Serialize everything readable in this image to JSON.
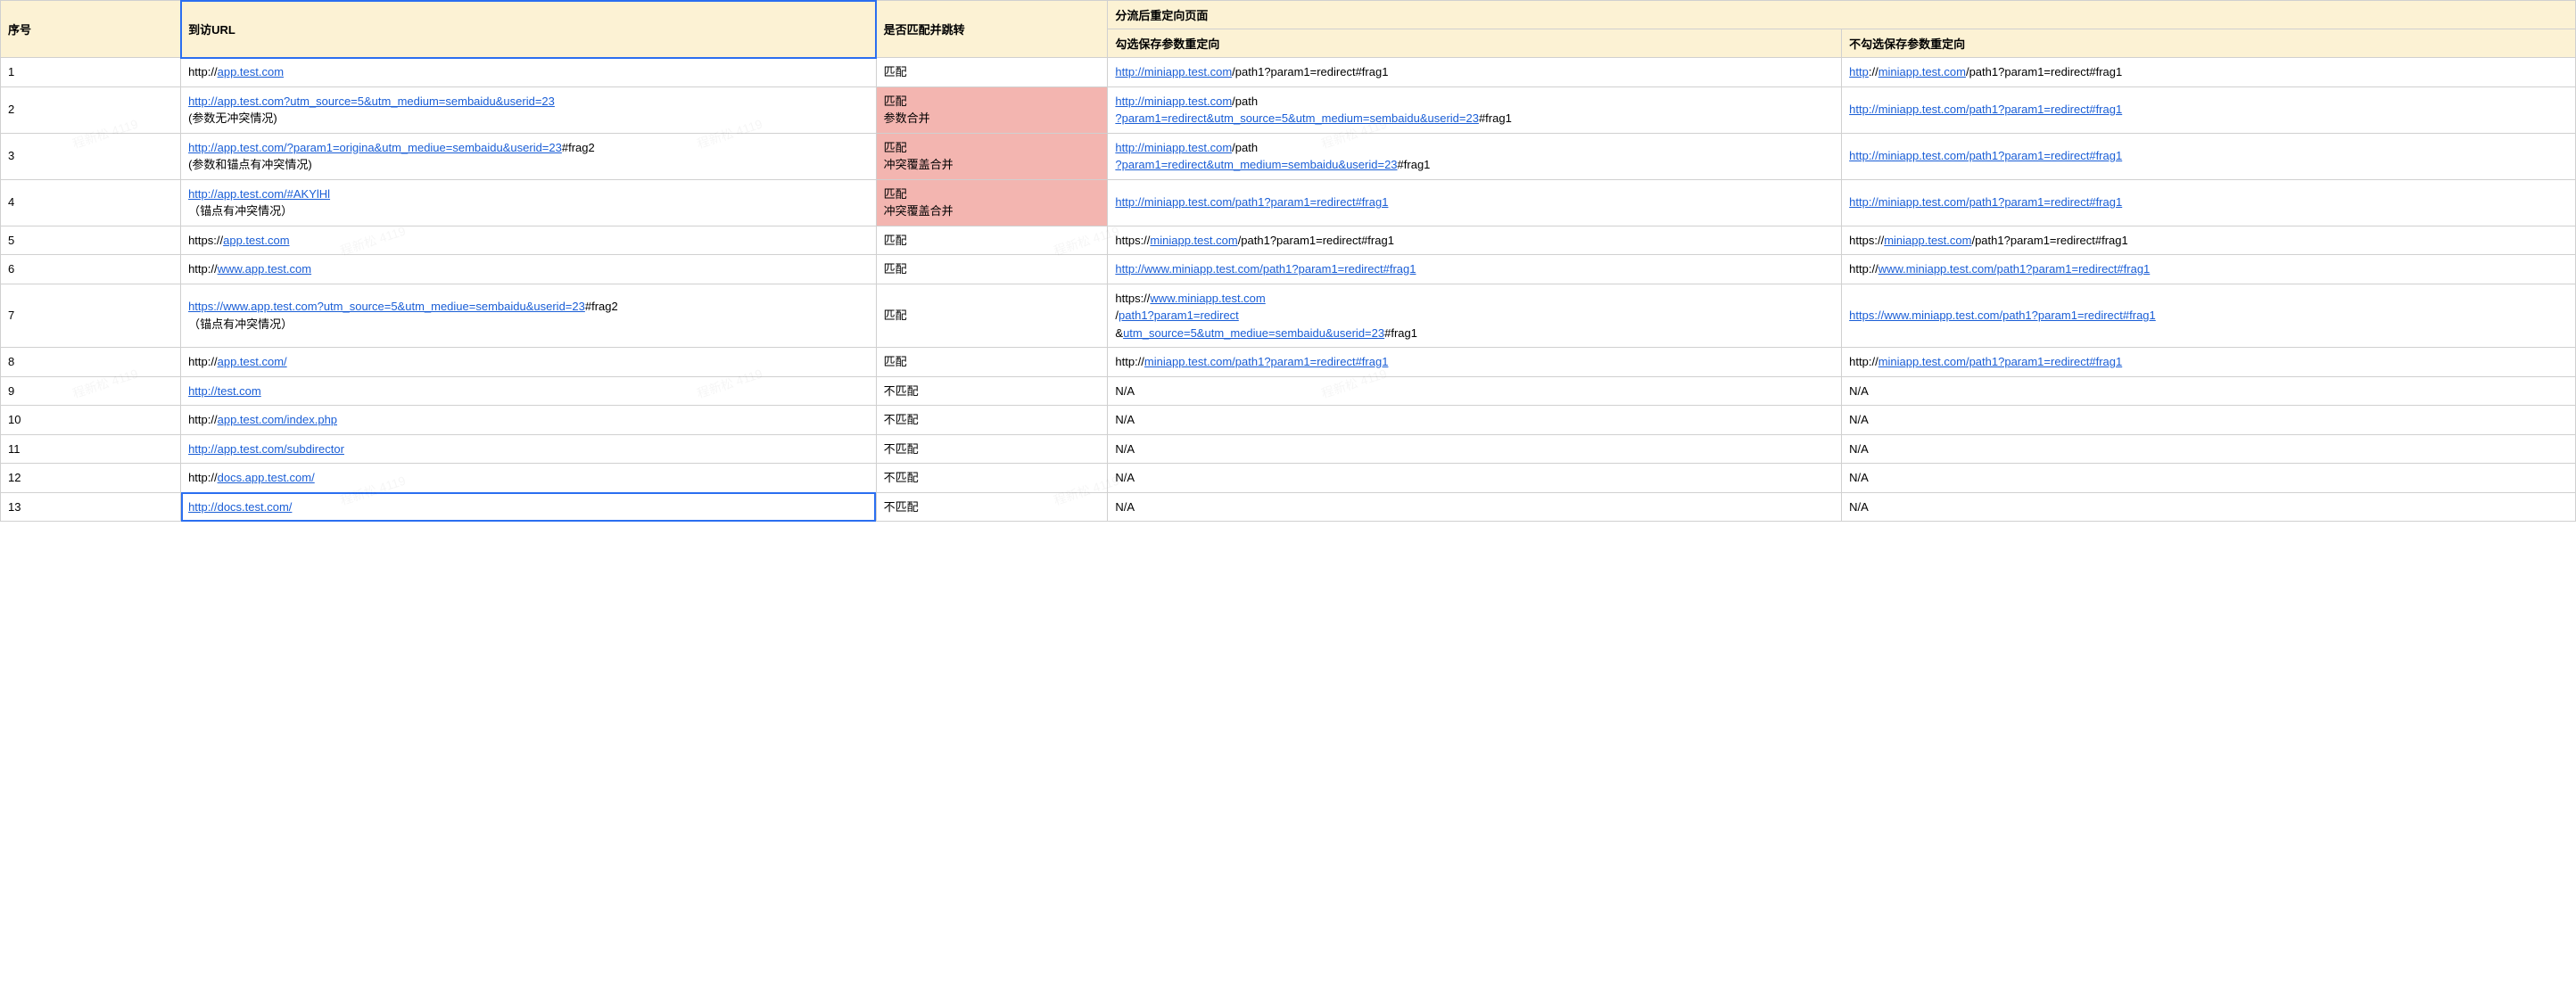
{
  "watermark_text": "程新松 4119",
  "headers": {
    "seq": "序号",
    "url": "到访URL",
    "match": "是否匹配并跳转",
    "redirect_group": "分流后重定向页面",
    "redirect_keep": "勾选保存参数重定向",
    "redirect_nokeep": "不勾选保存参数重定向"
  },
  "rows": [
    {
      "seq": "1",
      "url": [
        {
          "t": "plain",
          "v": "http://"
        },
        {
          "t": "link",
          "v": "app.test.com"
        }
      ],
      "match": {
        "pink": false,
        "text": "匹配"
      },
      "keep": [
        {
          "t": "link",
          "v": "http://miniapp.test.com"
        },
        {
          "t": "plain",
          "v": "/path1?param1=redirect#frag1"
        }
      ],
      "nokeep": [
        {
          "t": "link",
          "v": "http"
        },
        {
          "t": "plain",
          "v": "://"
        },
        {
          "t": "link",
          "v": "miniapp.test.com"
        },
        {
          "t": "plain",
          "v": "/path1?param1=redirect#frag1"
        }
      ]
    },
    {
      "seq": "2",
      "url": [
        {
          "t": "link",
          "v": "http://app.test.com?utm_source=5&utm_medium=sembaidu&userid=23"
        },
        {
          "t": "br"
        },
        {
          "t": "plain",
          "v": "(参数无冲突情况)"
        }
      ],
      "match": {
        "pink": true,
        "text": "匹配\n 参数合并"
      },
      "keep": [
        {
          "t": "link",
          "v": "http://miniapp.test.com"
        },
        {
          "t": "plain",
          "v": "/path"
        },
        {
          "t": "br"
        },
        {
          "t": "link",
          "v": "?param1=redirect&utm_source=5&utm_medium=sembaidu&userid=23"
        },
        {
          "t": "plain",
          "v": "#frag1"
        }
      ],
      "nokeep": [
        {
          "t": "link",
          "v": "http://miniapp.test.com/path1?param1=redirect#frag1"
        }
      ]
    },
    {
      "seq": "3",
      "url": [
        {
          "t": "link",
          "v": "http://app.test.com/?param1=origina&utm_mediue=sembaidu&userid=23"
        },
        {
          "t": "plain",
          "v": "#frag2"
        },
        {
          "t": "br"
        },
        {
          "t": "plain",
          "v": "(参数和锚点有冲突情况)"
        }
      ],
      "match": {
        "pink": true,
        "text": "匹配\n冲突覆盖合并"
      },
      "keep": [
        {
          "t": "link",
          "v": "http://miniapp.test.com"
        },
        {
          "t": "plain",
          "v": "/path"
        },
        {
          "t": "br"
        },
        {
          "t": "link",
          "v": "?param1=redirect&utm_medium=sembaidu&userid=23"
        },
        {
          "t": "plain",
          "v": "#frag1"
        }
      ],
      "nokeep": [
        {
          "t": "link",
          "v": "http://miniapp.test.com/path1?param1=redirect#frag1"
        }
      ]
    },
    {
      "seq": "4",
      "url": [
        {
          "t": "link",
          "v": "http://app.test.com/#AKYlHl"
        },
        {
          "t": "br"
        },
        {
          "t": "plain",
          "v": "（锚点有冲突情况）"
        }
      ],
      "match": {
        "pink": true,
        "text": "匹配\n冲突覆盖合并"
      },
      "keep": [
        {
          "t": "link",
          "v": "http://miniapp.test.com/path1?param1=redirect#frag1"
        }
      ],
      "nokeep": [
        {
          "t": "link",
          "v": "http://miniapp.test.com/path1?param1=redirect#frag1"
        }
      ]
    },
    {
      "seq": "5",
      "url": [
        {
          "t": "plain",
          "v": "https://"
        },
        {
          "t": "link",
          "v": "app.test.com"
        }
      ],
      "match": {
        "pink": false,
        "text": "匹配"
      },
      "keep": [
        {
          "t": "plain",
          "v": "https://"
        },
        {
          "t": "link",
          "v": "miniapp.test.com"
        },
        {
          "t": "plain",
          "v": "/path1?param1=redirect#frag1"
        }
      ],
      "nokeep": [
        {
          "t": "plain",
          "v": "https://"
        },
        {
          "t": "link",
          "v": "miniapp.test.com"
        },
        {
          "t": "plain",
          "v": "/path1?param1=redirect#frag1"
        }
      ]
    },
    {
      "seq": "6",
      "url": [
        {
          "t": "plain",
          "v": "http://"
        },
        {
          "t": "link",
          "v": "www.app.test.com"
        }
      ],
      "match": {
        "pink": false,
        "text": "匹配"
      },
      "keep": [
        {
          "t": "link",
          "v": "http://www.miniapp.test.com/path1?param1=redirect#frag1"
        }
      ],
      "nokeep": [
        {
          "t": "plain",
          "v": "http://"
        },
        {
          "t": "link",
          "v": "www.miniapp.test.com/path1?param1=redirect#frag1"
        }
      ]
    },
    {
      "seq": "7",
      "url": [
        {
          "t": "link",
          "v": "https://www.app.test.com?utm_source=5&utm_mediue=sembaidu&userid=23"
        },
        {
          "t": "plain",
          "v": "#frag2"
        },
        {
          "t": "br"
        },
        {
          "t": "plain",
          "v": "（锚点有冲突情况）"
        }
      ],
      "match": {
        "pink": false,
        "text": "匹配"
      },
      "keep": [
        {
          "t": "plain",
          "v": "https://"
        },
        {
          "t": "link",
          "v": "www.miniapp.test.com"
        },
        {
          "t": "br"
        },
        {
          "t": "plain",
          "v": "/"
        },
        {
          "t": "link",
          "v": "path1?param1=redirect"
        },
        {
          "t": "br"
        },
        {
          "t": "plain",
          "v": "&"
        },
        {
          "t": "link",
          "v": "utm_source=5&utm_mediue=sembaidu&userid=23"
        },
        {
          "t": "plain",
          "v": "#frag1"
        }
      ],
      "nokeep": [
        {
          "t": "link",
          "v": "https://www.miniapp.test.com/path1?param1=redirect#frag1"
        }
      ]
    },
    {
      "seq": "8",
      "url": [
        {
          "t": "plain",
          "v": "http://"
        },
        {
          "t": "link",
          "v": "app.test.com/"
        }
      ],
      "match": {
        "pink": false,
        "text": "匹配"
      },
      "keep": [
        {
          "t": "plain",
          "v": "http://"
        },
        {
          "t": "link",
          "v": "miniapp.test.com/path1?param1=redirect#frag1"
        }
      ],
      "nokeep": [
        {
          "t": "plain",
          "v": "http://"
        },
        {
          "t": "link",
          "v": "miniapp.test.com/path1?param1=redirect#frag1"
        }
      ]
    },
    {
      "seq": "9",
      "url": [
        {
          "t": "link",
          "v": "http://test.com"
        }
      ],
      "match": {
        "pink": false,
        "text": "不匹配"
      },
      "keep": [
        {
          "t": "plain",
          "v": "N/A"
        }
      ],
      "nokeep": [
        {
          "t": "plain",
          "v": "N/A"
        }
      ]
    },
    {
      "seq": "10",
      "url": [
        {
          "t": "plain",
          "v": "http://"
        },
        {
          "t": "link",
          "v": "app.test.com/index.php"
        }
      ],
      "match": {
        "pink": false,
        "text": "不匹配"
      },
      "keep": [
        {
          "t": "plain",
          "v": "N/A"
        }
      ],
      "nokeep": [
        {
          "t": "plain",
          "v": "N/A"
        }
      ]
    },
    {
      "seq": "11",
      "url": [
        {
          "t": "link",
          "v": "http://app.test.com/subdirector"
        }
      ],
      "match": {
        "pink": false,
        "text": "不匹配"
      },
      "keep": [
        {
          "t": "plain",
          "v": "N/A"
        }
      ],
      "nokeep": [
        {
          "t": "plain",
          "v": "N/A"
        }
      ]
    },
    {
      "seq": "12",
      "url": [
        {
          "t": "plain",
          "v": "http://"
        },
        {
          "t": "link",
          "v": "docs.app.test.com/"
        }
      ],
      "match": {
        "pink": false,
        "text": "不匹配"
      },
      "keep": [
        {
          "t": "plain",
          "v": "N/A"
        }
      ],
      "nokeep": [
        {
          "t": "plain",
          "v": "N/A"
        }
      ]
    },
    {
      "seq": "13",
      "url": [
        {
          "t": "link",
          "v": "http://docs.test.com/"
        }
      ],
      "url_selected": true,
      "match": {
        "pink": false,
        "text": "不匹配"
      },
      "keep": [
        {
          "t": "plain",
          "v": "N/A"
        }
      ],
      "nokeep": [
        {
          "t": "plain",
          "v": "N/A"
        }
      ]
    }
  ]
}
